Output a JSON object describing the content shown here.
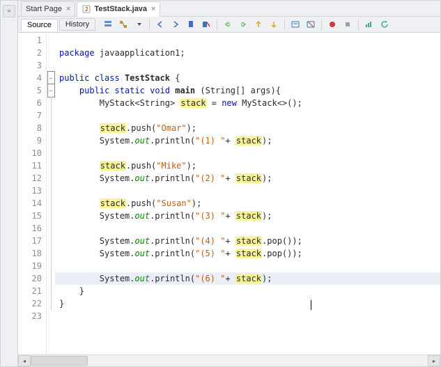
{
  "tabs": {
    "start_page": "Start Page",
    "file_name": "TestStack.java"
  },
  "sub_tabs": {
    "source": "Source",
    "history": "History"
  },
  "toolbar_icons": [
    "members-icon",
    "refactor-icon",
    "dropdown-icon",
    "sep",
    "prev-bookmark-icon",
    "next-bookmark-icon",
    "toggle-bookmark-icon",
    "clear-bookmarks-icon",
    "sep",
    "shift-left-icon",
    "shift-right-icon",
    "diff-icon",
    "next-diff-icon",
    "sep",
    "comment-icon",
    "uncomment-icon",
    "sep",
    "record-macro-icon",
    "stop-macro-icon",
    "sep",
    "chart-icon",
    "refresh-icon"
  ],
  "code": {
    "package_kw": "package",
    "package_name": "javaapplication1",
    "public_kw": "public",
    "class_kw": "class",
    "static_kw": "static",
    "void_kw": "void",
    "new_kw": "new",
    "class_name": "TestStack",
    "main_name": "main",
    "string_type": "String",
    "args_name": "args",
    "mystack_type": "MyStack",
    "stack_var": "stack",
    "mystack_ctor": "MyStack<>",
    "system_cls": "System",
    "out_field": "out",
    "println": "println",
    "push_method": "push",
    "pop_method": "pop",
    "str_omar": "\"Omar\"",
    "str_mike": "\"Mike\"",
    "str_susan": "\"Susan\"",
    "str_1": "\"(1) \"",
    "str_2": "\"(2) \"",
    "str_3": "\"(3) \"",
    "str_4": "\"(4) \"",
    "str_5": "\"(5) \"",
    "str_6": "\"(6) \""
  },
  "line_numbers": [
    "1",
    "2",
    "3",
    "4",
    "5",
    "6",
    "7",
    "8",
    "9",
    "10",
    "11",
    "12",
    "13",
    "14",
    "15",
    "16",
    "17",
    "18",
    "19",
    "20",
    "21",
    "22",
    "23"
  ]
}
